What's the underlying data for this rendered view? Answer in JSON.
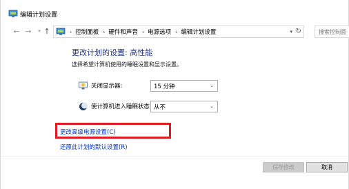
{
  "window": {
    "title": "编辑计划设置"
  },
  "nav": {
    "breadcrumbs": [
      "控制面板",
      "硬件和声音",
      "电源选项",
      "编辑计划设置"
    ],
    "search_placeholder": "搜索控制面"
  },
  "main": {
    "heading": "更改计划的设置: 高性能",
    "subtext": "选择希望计算机使用的睡眠设置和显示设置。",
    "settings": [
      {
        "label": "关闭显示器:",
        "value": "15 分钟",
        "icon": "monitor-icon"
      },
      {
        "label": "使计算机进入睡眠状态:",
        "value": "从不",
        "icon": "moon-icon"
      }
    ],
    "links": {
      "advanced": "更改高级电源设置(C)",
      "restore": "还原此计划的默认设置(R)"
    },
    "buttons": {
      "save": "保存修改",
      "cancel": "取消"
    }
  },
  "colors": {
    "heading": "#1e3287",
    "link": "#0033cc",
    "highlight": "#e01b24"
  }
}
